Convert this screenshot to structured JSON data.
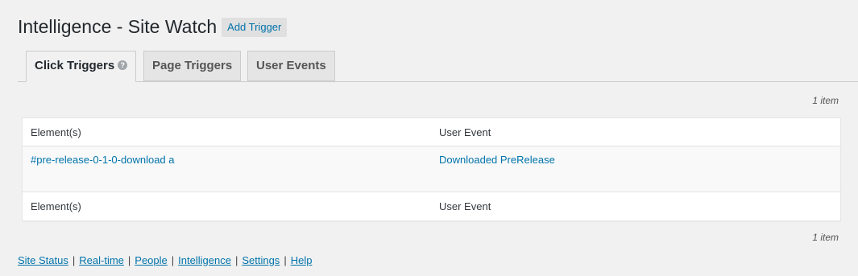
{
  "header": {
    "title": "Intelligence - Site Watch",
    "add_button": "Add Trigger"
  },
  "tabs": [
    {
      "label": "Click Triggers",
      "active": true,
      "help_icon": "question-circle-icon"
    },
    {
      "label": "Page Triggers",
      "active": false
    },
    {
      "label": "User Events",
      "active": false
    }
  ],
  "table": {
    "count_top": "1 item",
    "count_bottom": "1 item",
    "columns": [
      "Element(s)",
      "User Event"
    ],
    "rows": [
      {
        "element": "#pre-release-0-1-0-download a",
        "user_event": "Downloaded PreRelease"
      }
    ]
  },
  "footer_nav": [
    "Site Status",
    "Real-time",
    "People",
    "Intelligence",
    "Settings",
    "Help"
  ],
  "colors": {
    "link": "#0073aa",
    "background": "#f1f1f1"
  }
}
